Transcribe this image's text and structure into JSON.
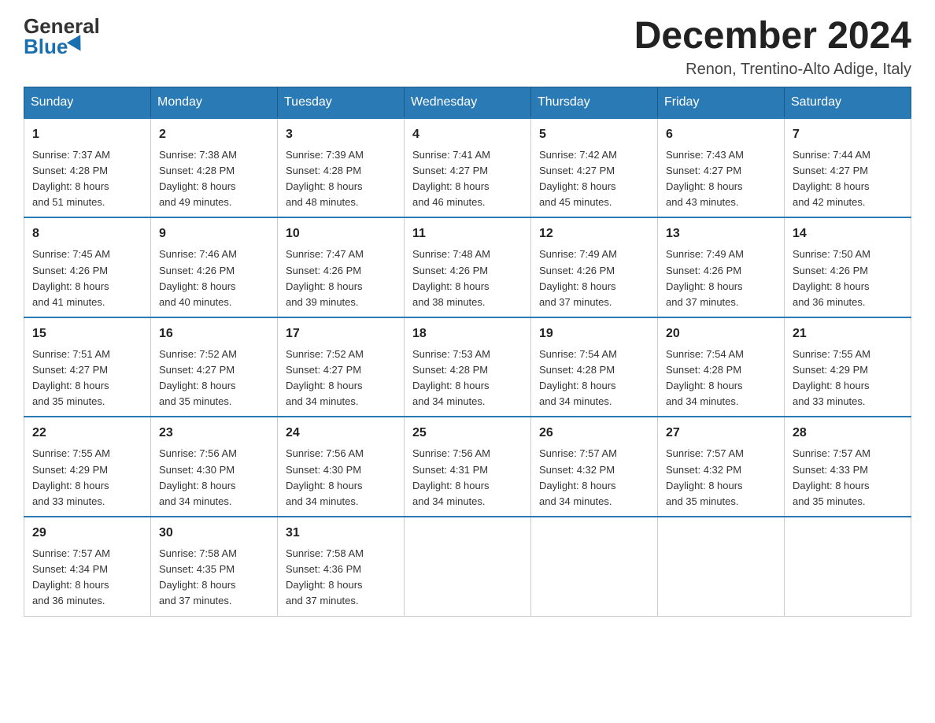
{
  "logo": {
    "general": "General",
    "blue": "Blue"
  },
  "title": "December 2024",
  "location": "Renon, Trentino-Alto Adige, Italy",
  "days_of_week": [
    "Sunday",
    "Monday",
    "Tuesday",
    "Wednesday",
    "Thursday",
    "Friday",
    "Saturday"
  ],
  "weeks": [
    [
      {
        "day": "1",
        "sunrise": "7:37 AM",
        "sunset": "4:28 PM",
        "daylight": "8 hours and 51 minutes."
      },
      {
        "day": "2",
        "sunrise": "7:38 AM",
        "sunset": "4:28 PM",
        "daylight": "8 hours and 49 minutes."
      },
      {
        "day": "3",
        "sunrise": "7:39 AM",
        "sunset": "4:28 PM",
        "daylight": "8 hours and 48 minutes."
      },
      {
        "day": "4",
        "sunrise": "7:41 AM",
        "sunset": "4:27 PM",
        "daylight": "8 hours and 46 minutes."
      },
      {
        "day": "5",
        "sunrise": "7:42 AM",
        "sunset": "4:27 PM",
        "daylight": "8 hours and 45 minutes."
      },
      {
        "day": "6",
        "sunrise": "7:43 AM",
        "sunset": "4:27 PM",
        "daylight": "8 hours and 43 minutes."
      },
      {
        "day": "7",
        "sunrise": "7:44 AM",
        "sunset": "4:27 PM",
        "daylight": "8 hours and 42 minutes."
      }
    ],
    [
      {
        "day": "8",
        "sunrise": "7:45 AM",
        "sunset": "4:26 PM",
        "daylight": "8 hours and 41 minutes."
      },
      {
        "day": "9",
        "sunrise": "7:46 AM",
        "sunset": "4:26 PM",
        "daylight": "8 hours and 40 minutes."
      },
      {
        "day": "10",
        "sunrise": "7:47 AM",
        "sunset": "4:26 PM",
        "daylight": "8 hours and 39 minutes."
      },
      {
        "day": "11",
        "sunrise": "7:48 AM",
        "sunset": "4:26 PM",
        "daylight": "8 hours and 38 minutes."
      },
      {
        "day": "12",
        "sunrise": "7:49 AM",
        "sunset": "4:26 PM",
        "daylight": "8 hours and 37 minutes."
      },
      {
        "day": "13",
        "sunrise": "7:49 AM",
        "sunset": "4:26 PM",
        "daylight": "8 hours and 37 minutes."
      },
      {
        "day": "14",
        "sunrise": "7:50 AM",
        "sunset": "4:26 PM",
        "daylight": "8 hours and 36 minutes."
      }
    ],
    [
      {
        "day": "15",
        "sunrise": "7:51 AM",
        "sunset": "4:27 PM",
        "daylight": "8 hours and 35 minutes."
      },
      {
        "day": "16",
        "sunrise": "7:52 AM",
        "sunset": "4:27 PM",
        "daylight": "8 hours and 35 minutes."
      },
      {
        "day": "17",
        "sunrise": "7:52 AM",
        "sunset": "4:27 PM",
        "daylight": "8 hours and 34 minutes."
      },
      {
        "day": "18",
        "sunrise": "7:53 AM",
        "sunset": "4:28 PM",
        "daylight": "8 hours and 34 minutes."
      },
      {
        "day": "19",
        "sunrise": "7:54 AM",
        "sunset": "4:28 PM",
        "daylight": "8 hours and 34 minutes."
      },
      {
        "day": "20",
        "sunrise": "7:54 AM",
        "sunset": "4:28 PM",
        "daylight": "8 hours and 34 minutes."
      },
      {
        "day": "21",
        "sunrise": "7:55 AM",
        "sunset": "4:29 PM",
        "daylight": "8 hours and 33 minutes."
      }
    ],
    [
      {
        "day": "22",
        "sunrise": "7:55 AM",
        "sunset": "4:29 PM",
        "daylight": "8 hours and 33 minutes."
      },
      {
        "day": "23",
        "sunrise": "7:56 AM",
        "sunset": "4:30 PM",
        "daylight": "8 hours and 34 minutes."
      },
      {
        "day": "24",
        "sunrise": "7:56 AM",
        "sunset": "4:30 PM",
        "daylight": "8 hours and 34 minutes."
      },
      {
        "day": "25",
        "sunrise": "7:56 AM",
        "sunset": "4:31 PM",
        "daylight": "8 hours and 34 minutes."
      },
      {
        "day": "26",
        "sunrise": "7:57 AM",
        "sunset": "4:32 PM",
        "daylight": "8 hours and 34 minutes."
      },
      {
        "day": "27",
        "sunrise": "7:57 AM",
        "sunset": "4:32 PM",
        "daylight": "8 hours and 35 minutes."
      },
      {
        "day": "28",
        "sunrise": "7:57 AM",
        "sunset": "4:33 PM",
        "daylight": "8 hours and 35 minutes."
      }
    ],
    [
      {
        "day": "29",
        "sunrise": "7:57 AM",
        "sunset": "4:34 PM",
        "daylight": "8 hours and 36 minutes."
      },
      {
        "day": "30",
        "sunrise": "7:58 AM",
        "sunset": "4:35 PM",
        "daylight": "8 hours and 37 minutes."
      },
      {
        "day": "31",
        "sunrise": "7:58 AM",
        "sunset": "4:36 PM",
        "daylight": "8 hours and 37 minutes."
      },
      null,
      null,
      null,
      null
    ]
  ],
  "labels": {
    "sunrise": "Sunrise:",
    "sunset": "Sunset:",
    "daylight": "Daylight:"
  }
}
